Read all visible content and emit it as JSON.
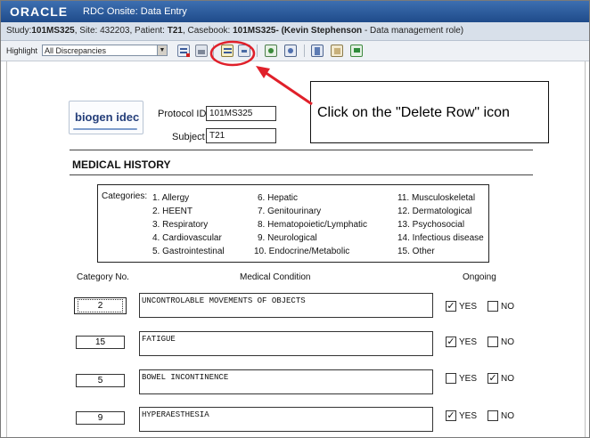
{
  "app": {
    "brand": "ORACLE",
    "title": "RDC Onsite: Data Entry"
  },
  "study_bar": {
    "study_label": "Study:",
    "study": "101MS325",
    "site_label": ", Site: ",
    "site": "432203",
    "patient_label": ", Patient: ",
    "patient": "T21",
    "casebook_label": ", Casebook: ",
    "casebook": "101MS325",
    "user": "- (Kevin Stephenson",
    "role": " - Data management role)"
  },
  "toolbar": {
    "highlight_label": "Highlight",
    "highlight_value": "All Discrepancies"
  },
  "callout": {
    "text": "Click on the \"Delete Row\" icon"
  },
  "form": {
    "logo_text": "biogen idec",
    "protocol_label": "Protocol ID",
    "protocol_value": "101MS325",
    "subject_label": "Subject",
    "subject_value": "T21",
    "section_title": "MEDICAL HISTORY",
    "categories_label": "Categories:",
    "categories": [
      "1. Allergy",
      "2. HEENT",
      "3. Respiratory",
      "4. Cardiovascular",
      "5. Gastrointestinal",
      "6. Hepatic",
      "7. Genitourinary",
      "8. Hematopoietic/Lymphatic",
      "9. Neurological",
      "10. Endocrine/Metabolic",
      "11. Musculoskeletal",
      "12. Dermatological",
      "13. Psychosocial",
      "14. Infectious disease",
      "15. Other"
    ],
    "columns": {
      "category_no": "Category No.",
      "condition": "Medical Condition",
      "ongoing": "Ongoing"
    },
    "yes_label": "YES",
    "no_label": "NO",
    "rows": [
      {
        "category": "2",
        "condition": "UNCONTROLABLE MOVEMENTS OF OBJECTS",
        "yes": "✓",
        "no": ""
      },
      {
        "category": "15",
        "condition": "FATIGUE",
        "yes": "✓",
        "no": ""
      },
      {
        "category": "5",
        "condition": "BOWEL INCONTINENCE",
        "yes": "",
        "no": "✓"
      },
      {
        "category": "9",
        "condition": "HYPERAESTHESIA",
        "yes": "✓",
        "no": ""
      }
    ]
  },
  "colors": {
    "title_bar": "#2a5a9c",
    "callout_arrow": "#e0202a"
  }
}
